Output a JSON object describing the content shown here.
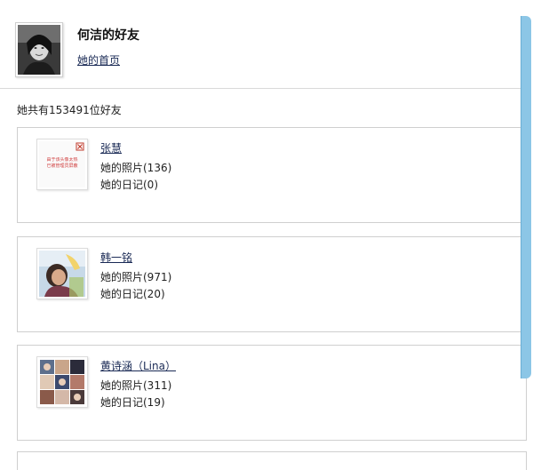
{
  "profile": {
    "title": "何洁的好友",
    "home_link": "她的首页"
  },
  "friends_count_text": "她共有153491位好友",
  "friends": [
    {
      "name": "张慧",
      "photos": "她的照片(136)",
      "diary": "她的日记(0)",
      "thumbnail": "broken-image",
      "broken_text": [
        "由于该头像太热",
        "已被管理员屏蔽"
      ]
    },
    {
      "name": "韩一铭",
      "photos": "她的照片(971)",
      "diary": "她的日记(20)",
      "thumbnail": "portrait-photo"
    },
    {
      "name": "黄诗涵（Lina）",
      "photos": "她的照片(311)",
      "diary": "她的日记(19)",
      "thumbnail": "photo-collage"
    }
  ],
  "colors": {
    "link": "#1a2a55",
    "border": "#cfcfcf",
    "scrollbar": "#8cc6e6"
  }
}
